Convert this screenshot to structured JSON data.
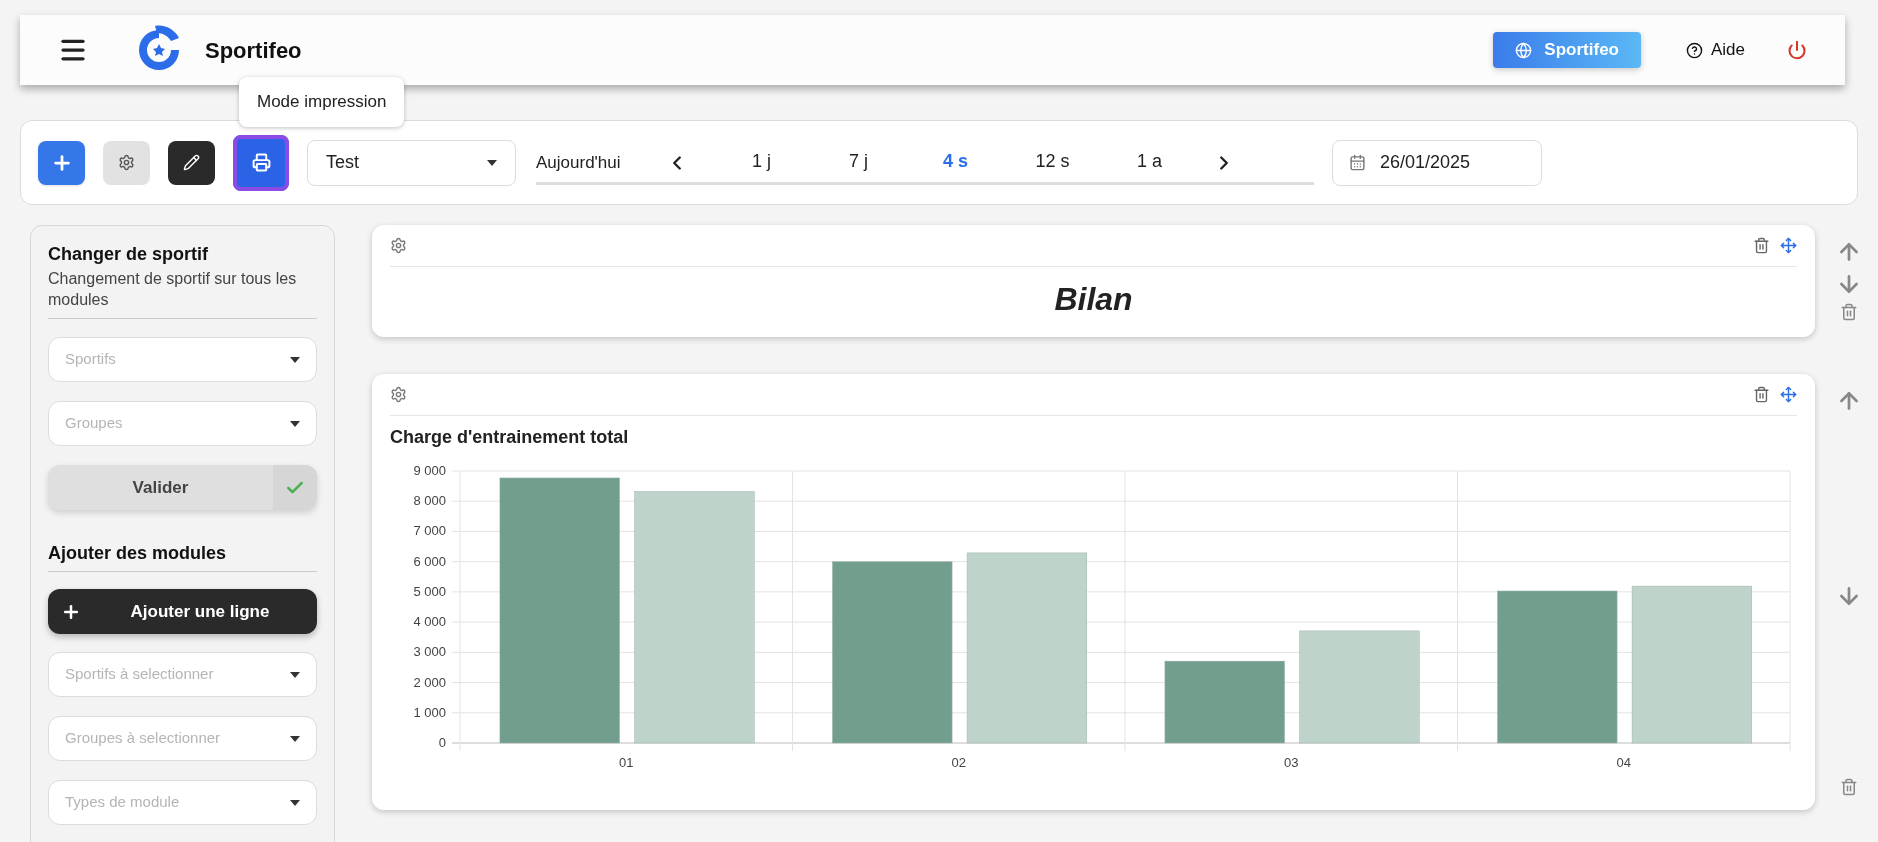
{
  "header": {
    "brand": "Sportifeo",
    "workspace_button": "Sportifeo",
    "help": "Aide"
  },
  "toolbar": {
    "print_button": {
      "focused": true
    },
    "tooltip": "Mode impression",
    "select": "Test",
    "today": "Aujourd'hui",
    "ranges": [
      {
        "label": "1 j",
        "selected": false
      },
      {
        "label": "7 j",
        "selected": false
      },
      {
        "label": "4 s",
        "selected": true
      },
      {
        "label": "12 s",
        "selected": false
      },
      {
        "label": "1 a",
        "selected": false
      }
    ],
    "date": "26/01/2025"
  },
  "sidebar": {
    "title": "Changer de sportif",
    "subtitle": "Changement de sportif sur tous les modules",
    "filters": [
      {
        "placeholder": "Sportifs"
      },
      {
        "placeholder": "Groupes"
      }
    ],
    "validate_button": "Valider",
    "modules_title": "Ajouter des modules",
    "add_line_button": "Ajouter une ligne",
    "module_filters": [
      {
        "placeholder": "Sportifs à selectionner"
      },
      {
        "placeholder": "Groupes à selectionner"
      },
      {
        "placeholder": "Types de module"
      }
    ]
  },
  "modules": [
    {
      "kind": "title",
      "title": "Bilan"
    },
    {
      "kind": "chart",
      "title": "Charge d'entrainement total",
      "chart_data": {
        "type": "bar",
        "categories": [
          "01",
          "02",
          "03",
          "04"
        ],
        "series": [
          {
            "color": "#729f8d",
            "values": [
              8770,
              6000,
              2710,
              5030
            ]
          },
          {
            "color": "#bed3ca",
            "values": [
              8320,
              6290,
              3710,
              5190
            ]
          }
        ],
        "ylim": [
          0,
          9000
        ],
        "grid": true,
        "yticks": [
          {
            "value": 0,
            "label": "0"
          },
          {
            "value": 1000,
            "label": "1 000"
          },
          {
            "value": 2000,
            "label": "2 000"
          },
          {
            "value": 3000,
            "label": "3 000"
          },
          {
            "value": 4000,
            "label": "4 000"
          },
          {
            "value": 5000,
            "label": "5 000"
          },
          {
            "value": 6000,
            "label": "6 000"
          },
          {
            "value": 7000,
            "label": "7 000"
          },
          {
            "value": 8000,
            "label": "8 000"
          },
          {
            "value": 9000,
            "label": "9 000"
          }
        ]
      }
    }
  ]
}
